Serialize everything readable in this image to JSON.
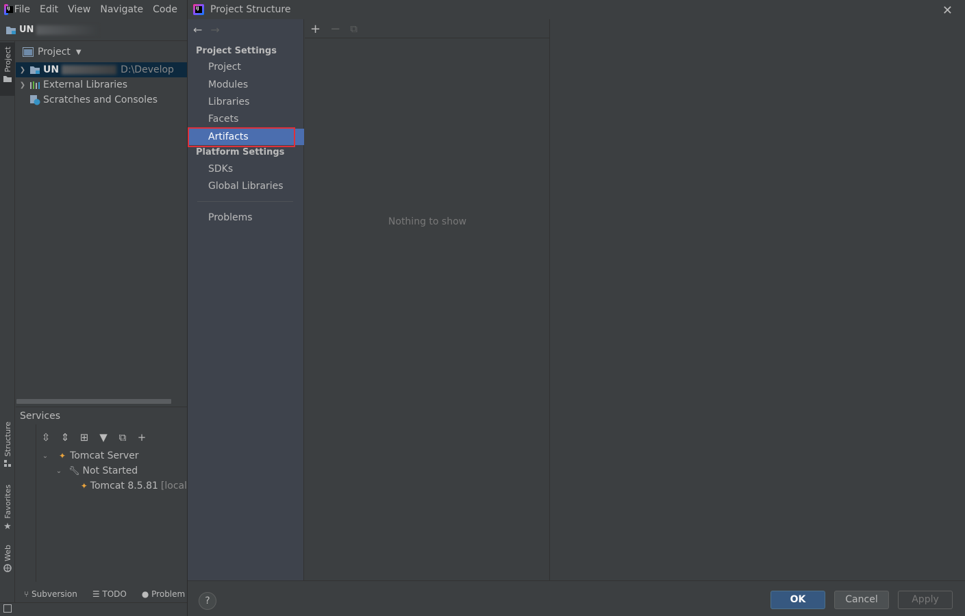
{
  "ide": {
    "menu": [
      "File",
      "Edit",
      "View",
      "Navigate",
      "Code"
    ],
    "breadcrumb": "UN",
    "left_stripe_tabs": [
      "Project",
      "Structure",
      "Favorites",
      "Web"
    ],
    "project_view": {
      "title": "Project",
      "tree": [
        {
          "label": "UN",
          "suffix": "D:\\Develop"
        },
        {
          "label": "External Libraries"
        },
        {
          "label": "Scratches and Consoles"
        }
      ]
    },
    "services": {
      "title": "Services",
      "tree": [
        {
          "label": "Tomcat Server"
        },
        {
          "label": "Not Started"
        },
        {
          "label": "Tomcat 8.5.81",
          "suffix": "[local"
        }
      ]
    },
    "status_tabs": [
      "Subversion",
      "TODO",
      "Problem"
    ]
  },
  "dialog": {
    "title": "Project Structure",
    "sections": {
      "project_settings": "Project Settings",
      "platform_settings": "Platform Settings"
    },
    "nav_items": {
      "project": "Project",
      "modules": "Modules",
      "libraries": "Libraries",
      "facets": "Facets",
      "artifacts": "Artifacts",
      "sdks": "SDKs",
      "global_libraries": "Global Libraries",
      "problems": "Problems"
    },
    "selected_item": "Artifacts",
    "empty_text": "Nothing to show",
    "buttons": {
      "help": "?",
      "ok": "OK",
      "cancel": "Cancel",
      "apply": "Apply"
    }
  },
  "colors": {
    "background": "#3c3f41",
    "nav_pane": "#3e434c",
    "selection": "#4b6eaf",
    "highlight_box": "#e0303a",
    "ok_button": "#365880"
  }
}
